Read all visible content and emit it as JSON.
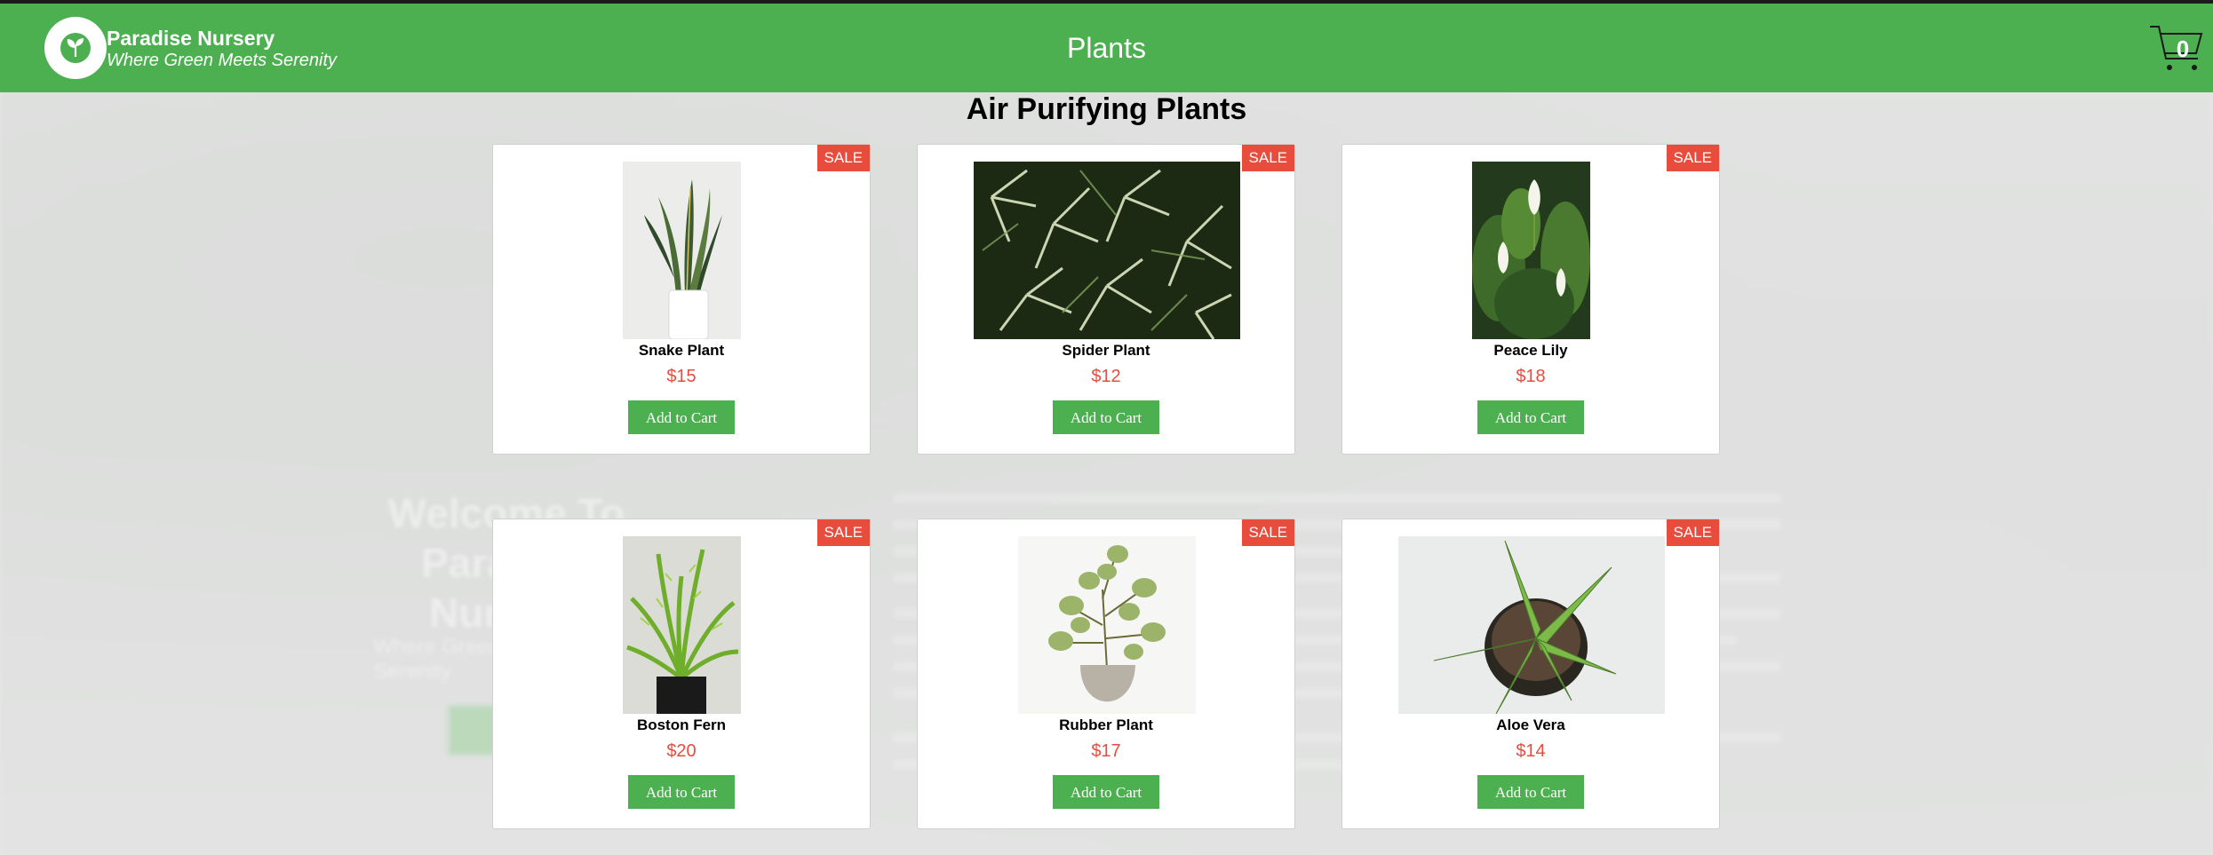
{
  "header": {
    "brand_name": "Paradise Nursery",
    "brand_tagline": "Where Green Meets Serenity",
    "page_title": "Plants",
    "cart_count": "0"
  },
  "background_hint": {
    "heading": "Welcome To Paradise Nursery",
    "subheading": "Where Green Meets Serenity"
  },
  "section": {
    "title": "Air Purifying Plants",
    "products": [
      {
        "name": "Snake Plant",
        "price": "$15",
        "badge": "SALE",
        "button": "Add to Cart"
      },
      {
        "name": "Spider Plant",
        "price": "$12",
        "badge": "SALE",
        "button": "Add to Cart"
      },
      {
        "name": "Peace Lily",
        "price": "$18",
        "badge": "SALE",
        "button": "Add to Cart"
      },
      {
        "name": "Boston Fern",
        "price": "$20",
        "badge": "SALE",
        "button": "Add to Cart"
      },
      {
        "name": "Rubber Plant",
        "price": "$17",
        "badge": "SALE",
        "button": "Add to Cart"
      },
      {
        "name": "Aloe Vera",
        "price": "$14",
        "badge": "SALE",
        "button": "Add to Cart"
      }
    ]
  },
  "colors": {
    "header_green": "#4caf50",
    "button_green": "#4caf50",
    "sale_red": "#e74c3c",
    "price_red": "#e74c3c"
  },
  "icons": [
    "leaf-logo-icon",
    "cart-icon"
  ]
}
